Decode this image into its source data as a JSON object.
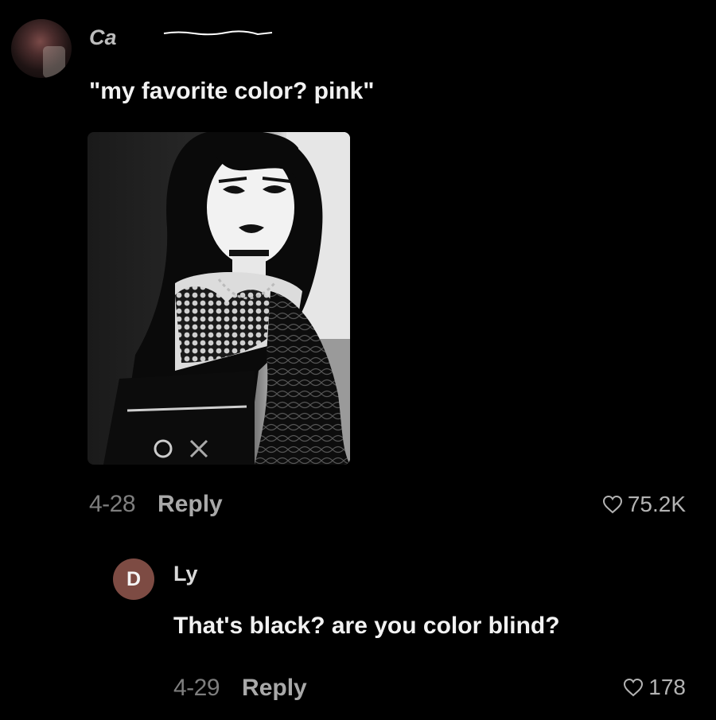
{
  "comment": {
    "username": "Ca",
    "text": "\"my favorite color? pink\"",
    "date": "4-28",
    "reply_label": "Reply",
    "likes": "75.2K"
  },
  "reply": {
    "avatar_initial": "D",
    "username": "Ly",
    "text": "That's black? are you color blind?",
    "date": "4-29",
    "reply_label": "Reply",
    "likes": "178"
  },
  "colors": {
    "background": "#000000",
    "reply_avatar": "#7d4b43"
  },
  "icons": {
    "like": "heart-outline-icon"
  }
}
